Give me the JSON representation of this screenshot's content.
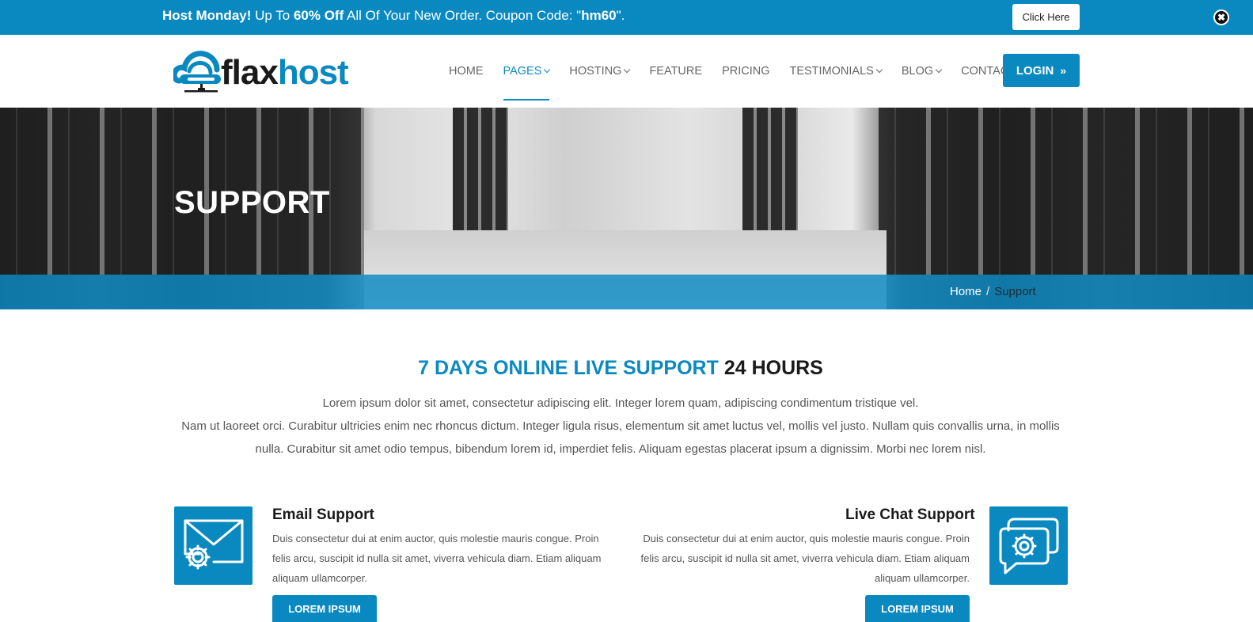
{
  "topbar": {
    "promo_bold1": "Host Monday!",
    "promo_text1": " Up To ",
    "promo_bold2": "60% Off",
    "promo_text2": " All Of Your New Order. Coupon Code: \"",
    "promo_code": "hm60",
    "promo_text3": "\".",
    "button_label": "Click Here",
    "close_glyph": "✖"
  },
  "logo": {
    "part1": "flax",
    "part2": "host"
  },
  "nav": {
    "items": [
      {
        "label": "HOME",
        "dropdown": false,
        "active": false
      },
      {
        "label": "PAGES",
        "dropdown": true,
        "active": true
      },
      {
        "label": "HOSTING",
        "dropdown": true,
        "active": false
      },
      {
        "label": "FEATURE",
        "dropdown": false,
        "active": false
      },
      {
        "label": "PRICING",
        "dropdown": false,
        "active": false
      },
      {
        "label": "TESTIMONIALS",
        "dropdown": true,
        "active": false
      },
      {
        "label": "BLOG",
        "dropdown": true,
        "active": false
      },
      {
        "label": "CONTACT",
        "dropdown": false,
        "active": false
      }
    ],
    "login_label": "LOGIN",
    "login_glyph": "»"
  },
  "hero": {
    "title": "SUPPORT",
    "breadcrumb": {
      "home": "Home",
      "separator": "/",
      "current": "Support"
    }
  },
  "section": {
    "title_blue": "7 DAYS ONLINE LIVE SUPPORT",
    "title_dark": "24 HOURS",
    "intro_line1": "Lorem ipsum dolor sit amet, consectetur adipiscing elit. Integer lorem quam, adipiscing condimentum tristique vel.",
    "intro_line2": "Nam ut laoreet orci. Curabitur ultricies enim nec rhoncus dictum. Integer ligula risus, elementum sit amet luctus vel, mollis vel justo. Nullam quis convallis urna, in mollis nulla. Curabitur sit amet odio tempus, bibendum lorem id, imperdiet felis. Aliquam egestas placerat ipsum a dignissim. Morbi nec lorem nisl."
  },
  "features": [
    {
      "title": "Email Support",
      "text": "Duis consectetur dui at enim auctor, quis molestie mauris congue. Proin felis arcu, suscipit id nulla sit amet, viverra vehicula diam. Etiam aliquam aliquam ullamcorper.",
      "button": "LOREM IPSUM",
      "icon": "email-gear-icon"
    },
    {
      "title": "Live Chat Support",
      "text": "Duis consectetur dui at enim auctor, quis molestie mauris congue. Proin felis arcu, suscipit id nulla sit amet, viverra vehicula diam. Etiam aliquam aliquam ullamcorper.",
      "button": "LOREM IPSUM",
      "icon": "chat-gear-icon"
    }
  ],
  "colors": {
    "accent": "#0a89c1",
    "dark": "#1a1a1a",
    "text": "#555555"
  }
}
